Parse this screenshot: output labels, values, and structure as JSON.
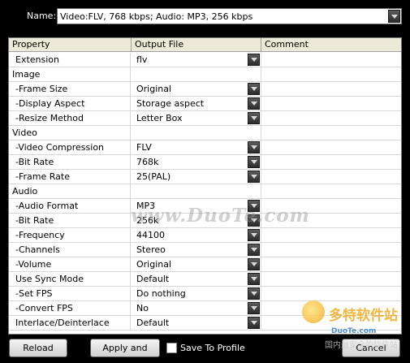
{
  "name_field": {
    "label": "Name:",
    "value": "Video:FLV, 768 kbps; Audio: MP3, 256 kbps"
  },
  "grid": {
    "columns": [
      "Property",
      "Output File",
      "Comment"
    ],
    "rows": [
      {
        "property": "Extension",
        "indent": true,
        "value": "flv",
        "dropdown": true
      },
      {
        "property": "Image",
        "indent": false,
        "value": "",
        "dropdown": false
      },
      {
        "property": "-Frame Size",
        "indent": true,
        "value": "Original",
        "dropdown": true
      },
      {
        "property": "-Display Aspect",
        "indent": true,
        "value": "Storage aspect",
        "dropdown": true
      },
      {
        "property": "-Resize Method",
        "indent": true,
        "value": "Letter Box",
        "dropdown": true
      },
      {
        "property": "Video",
        "indent": false,
        "value": "",
        "dropdown": false
      },
      {
        "property": "-Video Compression",
        "indent": true,
        "value": "FLV",
        "dropdown": true
      },
      {
        "property": "-Bit Rate",
        "indent": true,
        "value": "768k",
        "dropdown": true
      },
      {
        "property": "-Frame Rate",
        "indent": true,
        "value": "25(PAL)",
        "dropdown": true
      },
      {
        "property": "Audio",
        "indent": false,
        "value": "",
        "dropdown": false
      },
      {
        "property": "-Audio Format",
        "indent": true,
        "value": "MP3",
        "dropdown": true
      },
      {
        "property": "-Bit Rate",
        "indent": true,
        "value": "256k",
        "dropdown": true
      },
      {
        "property": "-Frequency",
        "indent": true,
        "value": "44100",
        "dropdown": true
      },
      {
        "property": "-Channels",
        "indent": true,
        "value": "Stereo",
        "dropdown": true
      },
      {
        "property": "-Volume",
        "indent": true,
        "value": "Original",
        "dropdown": true
      },
      {
        "property": "Use Sync Mode",
        "indent": true,
        "value": "Default",
        "dropdown": true
      },
      {
        "property": "-Set FPS",
        "indent": true,
        "value": "Do nothing",
        "dropdown": true
      },
      {
        "property": "-Convert FPS",
        "indent": true,
        "value": "No",
        "dropdown": true
      },
      {
        "property": "Interlace/Deinterlace",
        "indent": true,
        "value": "Default",
        "dropdown": true
      }
    ]
  },
  "watermark": "www.DuoTe.com",
  "logo": {
    "title": "多特软件站",
    "subtitle": "DuoTe.com",
    "caption": "国内最安全的软件站"
  },
  "footer": {
    "reload_label": "Reload",
    "apply_label": "Apply and Close",
    "save_profile_label": "Save To Profile",
    "save_profile_checked": false,
    "cancel_label": "Cancel"
  },
  "colors": {
    "background": "#000000",
    "grid_bg": "#ffffff",
    "header_bg": "#ece9d8",
    "dropdown_btn": "#3a3a3a"
  }
}
